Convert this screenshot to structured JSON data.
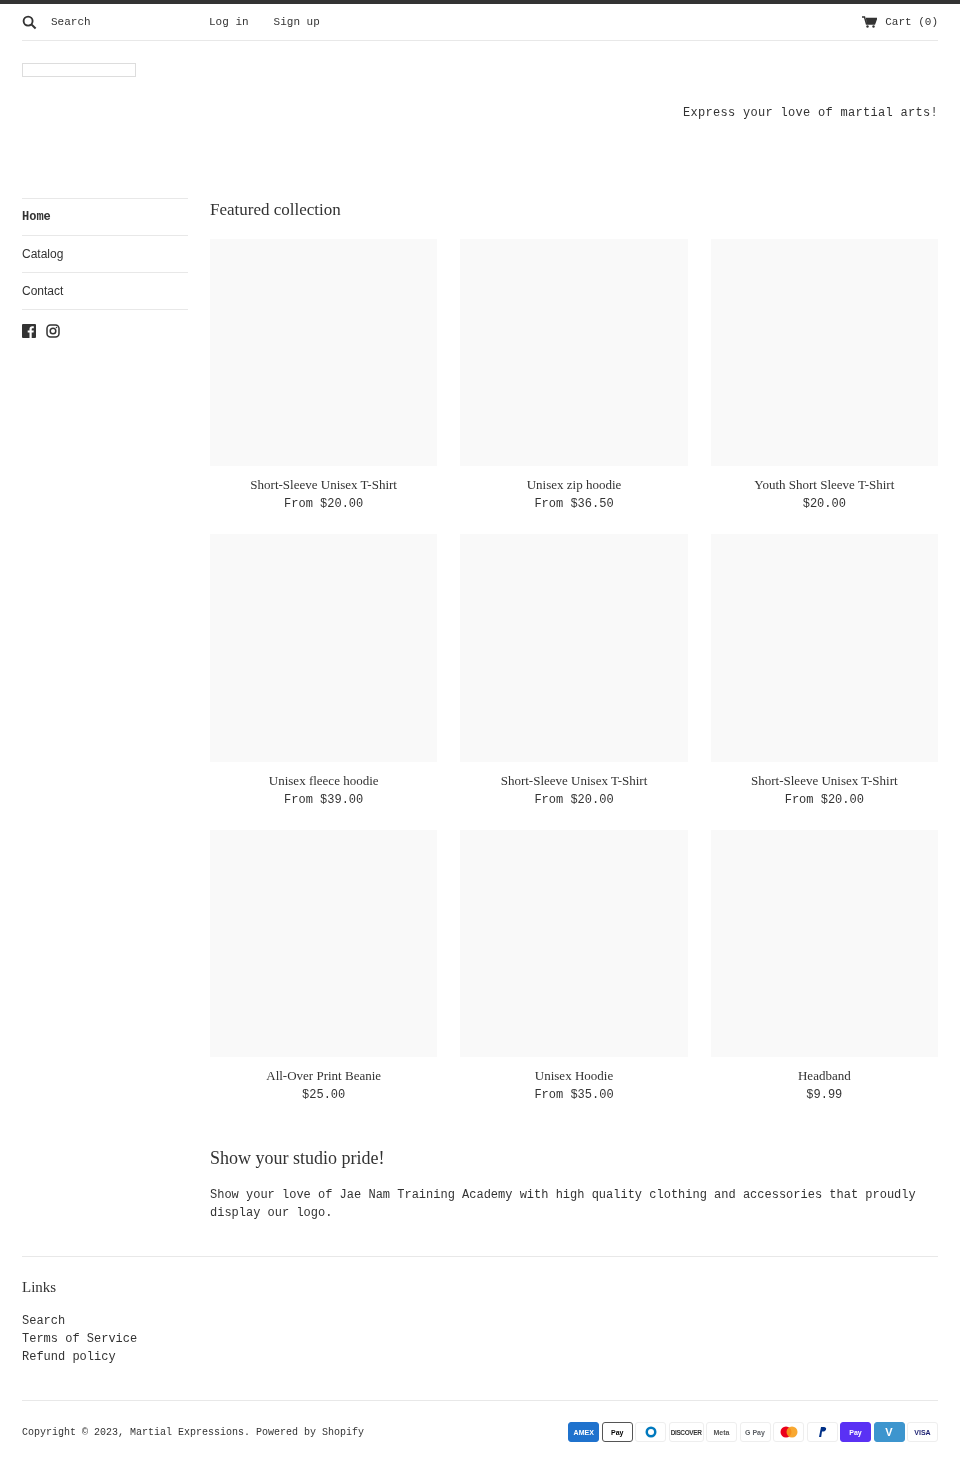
{
  "header": {
    "search": {
      "placeholder": "Search"
    },
    "account_links": [
      "Log in",
      "Sign up"
    ],
    "cart": "Cart (0)"
  },
  "tagline": "Express your love of martial arts!",
  "sidebar": {
    "items": [
      {
        "label": "Home",
        "selected": true
      },
      {
        "label": "Catalog",
        "selected": false
      },
      {
        "label": "Contact",
        "selected": false
      }
    ]
  },
  "featured": {
    "title": "Featured collection",
    "products": [
      {
        "name": "Short-Sleeve Unisex T-Shirt",
        "price": "From $20.00"
      },
      {
        "name": "Unisex zip hoodie",
        "price": "From $36.50"
      },
      {
        "name": "Youth Short Sleeve T-Shirt",
        "price": "$20.00"
      },
      {
        "name": "Unisex fleece hoodie",
        "price": "From $39.00"
      },
      {
        "name": "Short-Sleeve Unisex T-Shirt",
        "price": "From $20.00"
      },
      {
        "name": "Short-Sleeve Unisex T-Shirt",
        "price": "From $20.00"
      },
      {
        "name": "All-Over Print Beanie",
        "price": "$25.00"
      },
      {
        "name": "Unisex Hoodie",
        "price": "From $35.00"
      },
      {
        "name": "Headband",
        "price": "$9.99"
      }
    ]
  },
  "promo": {
    "title": "Show your studio pride!",
    "text": "Show your love of Jae Nam Training Academy with high quality clothing and accessories that proudly display our logo."
  },
  "footer": {
    "links_title": "Links",
    "links": [
      "Search",
      "Terms of Service",
      "Refund policy"
    ],
    "copyright": "Copyright © 2023, Martial Expressions. Powered by Shopify",
    "payments": [
      {
        "kind": "amex",
        "label": "AMEX"
      },
      {
        "kind": "applepay",
        "label": "Pay"
      },
      {
        "kind": "diners"
      },
      {
        "kind": "discover",
        "label": "DISCOVER"
      },
      {
        "kind": "meta",
        "label": "Meta"
      },
      {
        "kind": "gpay",
        "label": "G Pay"
      },
      {
        "kind": "mastercard"
      },
      {
        "kind": "paypal"
      },
      {
        "kind": "shoppay",
        "label": "Pay"
      },
      {
        "kind": "venmo",
        "label": "V"
      },
      {
        "kind": "visa",
        "label": "VISA"
      }
    ]
  }
}
